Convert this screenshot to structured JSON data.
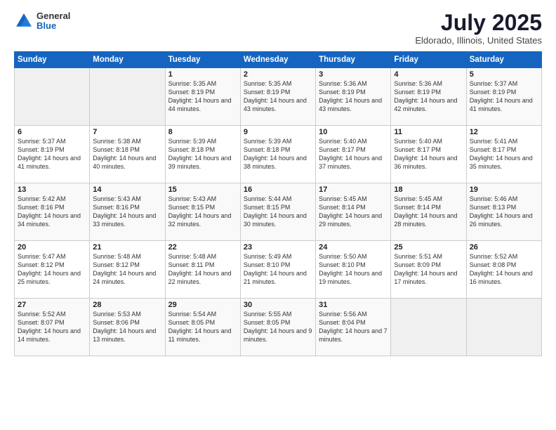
{
  "header": {
    "logo": {
      "general": "General",
      "blue": "Blue"
    },
    "title": "July 2025",
    "location": "Eldorado, Illinois, United States"
  },
  "weekdays": [
    "Sunday",
    "Monday",
    "Tuesday",
    "Wednesday",
    "Thursday",
    "Friday",
    "Saturday"
  ],
  "weeks": [
    [
      {
        "day": null,
        "sunrise": null,
        "sunset": null,
        "daylight": null
      },
      {
        "day": null,
        "sunrise": null,
        "sunset": null,
        "daylight": null
      },
      {
        "day": "1",
        "sunrise": "Sunrise: 5:35 AM",
        "sunset": "Sunset: 8:19 PM",
        "daylight": "Daylight: 14 hours and 44 minutes."
      },
      {
        "day": "2",
        "sunrise": "Sunrise: 5:35 AM",
        "sunset": "Sunset: 8:19 PM",
        "daylight": "Daylight: 14 hours and 43 minutes."
      },
      {
        "day": "3",
        "sunrise": "Sunrise: 5:36 AM",
        "sunset": "Sunset: 8:19 PM",
        "daylight": "Daylight: 14 hours and 43 minutes."
      },
      {
        "day": "4",
        "sunrise": "Sunrise: 5:36 AM",
        "sunset": "Sunset: 8:19 PM",
        "daylight": "Daylight: 14 hours and 42 minutes."
      },
      {
        "day": "5",
        "sunrise": "Sunrise: 5:37 AM",
        "sunset": "Sunset: 8:19 PM",
        "daylight": "Daylight: 14 hours and 41 minutes."
      }
    ],
    [
      {
        "day": "6",
        "sunrise": "Sunrise: 5:37 AM",
        "sunset": "Sunset: 8:19 PM",
        "daylight": "Daylight: 14 hours and 41 minutes."
      },
      {
        "day": "7",
        "sunrise": "Sunrise: 5:38 AM",
        "sunset": "Sunset: 8:18 PM",
        "daylight": "Daylight: 14 hours and 40 minutes."
      },
      {
        "day": "8",
        "sunrise": "Sunrise: 5:39 AM",
        "sunset": "Sunset: 8:18 PM",
        "daylight": "Daylight: 14 hours and 39 minutes."
      },
      {
        "day": "9",
        "sunrise": "Sunrise: 5:39 AM",
        "sunset": "Sunset: 8:18 PM",
        "daylight": "Daylight: 14 hours and 38 minutes."
      },
      {
        "day": "10",
        "sunrise": "Sunrise: 5:40 AM",
        "sunset": "Sunset: 8:17 PM",
        "daylight": "Daylight: 14 hours and 37 minutes."
      },
      {
        "day": "11",
        "sunrise": "Sunrise: 5:40 AM",
        "sunset": "Sunset: 8:17 PM",
        "daylight": "Daylight: 14 hours and 36 minutes."
      },
      {
        "day": "12",
        "sunrise": "Sunrise: 5:41 AM",
        "sunset": "Sunset: 8:17 PM",
        "daylight": "Daylight: 14 hours and 35 minutes."
      }
    ],
    [
      {
        "day": "13",
        "sunrise": "Sunrise: 5:42 AM",
        "sunset": "Sunset: 8:16 PM",
        "daylight": "Daylight: 14 hours and 34 minutes."
      },
      {
        "day": "14",
        "sunrise": "Sunrise: 5:43 AM",
        "sunset": "Sunset: 8:16 PM",
        "daylight": "Daylight: 14 hours and 33 minutes."
      },
      {
        "day": "15",
        "sunrise": "Sunrise: 5:43 AM",
        "sunset": "Sunset: 8:15 PM",
        "daylight": "Daylight: 14 hours and 32 minutes."
      },
      {
        "day": "16",
        "sunrise": "Sunrise: 5:44 AM",
        "sunset": "Sunset: 8:15 PM",
        "daylight": "Daylight: 14 hours and 30 minutes."
      },
      {
        "day": "17",
        "sunrise": "Sunrise: 5:45 AM",
        "sunset": "Sunset: 8:14 PM",
        "daylight": "Daylight: 14 hours and 29 minutes."
      },
      {
        "day": "18",
        "sunrise": "Sunrise: 5:45 AM",
        "sunset": "Sunset: 8:14 PM",
        "daylight": "Daylight: 14 hours and 28 minutes."
      },
      {
        "day": "19",
        "sunrise": "Sunrise: 5:46 AM",
        "sunset": "Sunset: 8:13 PM",
        "daylight": "Daylight: 14 hours and 26 minutes."
      }
    ],
    [
      {
        "day": "20",
        "sunrise": "Sunrise: 5:47 AM",
        "sunset": "Sunset: 8:12 PM",
        "daylight": "Daylight: 14 hours and 25 minutes."
      },
      {
        "day": "21",
        "sunrise": "Sunrise: 5:48 AM",
        "sunset": "Sunset: 8:12 PM",
        "daylight": "Daylight: 14 hours and 24 minutes."
      },
      {
        "day": "22",
        "sunrise": "Sunrise: 5:48 AM",
        "sunset": "Sunset: 8:11 PM",
        "daylight": "Daylight: 14 hours and 22 minutes."
      },
      {
        "day": "23",
        "sunrise": "Sunrise: 5:49 AM",
        "sunset": "Sunset: 8:10 PM",
        "daylight": "Daylight: 14 hours and 21 minutes."
      },
      {
        "day": "24",
        "sunrise": "Sunrise: 5:50 AM",
        "sunset": "Sunset: 8:10 PM",
        "daylight": "Daylight: 14 hours and 19 minutes."
      },
      {
        "day": "25",
        "sunrise": "Sunrise: 5:51 AM",
        "sunset": "Sunset: 8:09 PM",
        "daylight": "Daylight: 14 hours and 17 minutes."
      },
      {
        "day": "26",
        "sunrise": "Sunrise: 5:52 AM",
        "sunset": "Sunset: 8:08 PM",
        "daylight": "Daylight: 14 hours and 16 minutes."
      }
    ],
    [
      {
        "day": "27",
        "sunrise": "Sunrise: 5:52 AM",
        "sunset": "Sunset: 8:07 PM",
        "daylight": "Daylight: 14 hours and 14 minutes."
      },
      {
        "day": "28",
        "sunrise": "Sunrise: 5:53 AM",
        "sunset": "Sunset: 8:06 PM",
        "daylight": "Daylight: 14 hours and 13 minutes."
      },
      {
        "day": "29",
        "sunrise": "Sunrise: 5:54 AM",
        "sunset": "Sunset: 8:05 PM",
        "daylight": "Daylight: 14 hours and 11 minutes."
      },
      {
        "day": "30",
        "sunrise": "Sunrise: 5:55 AM",
        "sunset": "Sunset: 8:05 PM",
        "daylight": "Daylight: 14 hours and 9 minutes."
      },
      {
        "day": "31",
        "sunrise": "Sunrise: 5:56 AM",
        "sunset": "Sunset: 8:04 PM",
        "daylight": "Daylight: 14 hours and 7 minutes."
      },
      {
        "day": null,
        "sunrise": null,
        "sunset": null,
        "daylight": null
      },
      {
        "day": null,
        "sunrise": null,
        "sunset": null,
        "daylight": null
      }
    ]
  ]
}
